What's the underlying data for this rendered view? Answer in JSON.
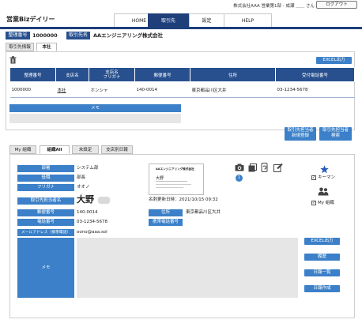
{
  "topbar": {
    "user_info": "株式会社AAA 営業第1部 - 成瀬 ＿＿ さん",
    "logout_label": "ログアウト"
  },
  "app": {
    "title": "営業Bizデイリー",
    "nav": [
      {
        "label": "HOME",
        "active": false
      },
      {
        "label": "取引先",
        "active": true
      },
      {
        "label": "設定",
        "active": false
      },
      {
        "label": "HELP",
        "active": false
      }
    ]
  },
  "header": {
    "id_label": "整理番号",
    "id_value": "1000000",
    "client_label": "取引先名",
    "client_value": "AAエンジニアリング株式会社"
  },
  "section_tabs": [
    {
      "label": "取引先情報",
      "active": false
    },
    {
      "label": "本社",
      "active": true
    }
  ],
  "office_table": {
    "excel_label": "EXCEL出力",
    "columns": [
      "整理番号",
      "支店名",
      "支店名\nフリガナ",
      "郵便番号",
      "住所",
      "受付電話番号"
    ],
    "rows": [
      [
        "1000000",
        "本社",
        "ホンシャ",
        "140-0014",
        "東京都品川区大井",
        "03-1234-5678"
      ]
    ],
    "memo_label": "メモ"
  },
  "contact_actions": {
    "register_label": "取引先担当者\n新規登録",
    "search_label": "取引先担当者\n検索"
  },
  "contact_tabs": [
    {
      "label": "My 組織",
      "active": false
    },
    {
      "label": "組織All",
      "active": true
    },
    {
      "label": "未設定",
      "active": false
    },
    {
      "label": "支店別日報",
      "active": false
    }
  ],
  "contact": {
    "department_label": "部署",
    "department_value": "システム部",
    "position_label": "役職",
    "position_value": "部長",
    "furigana_label": "フリガナ",
    "furigana_value": "オオノ",
    "name_label": "取引先担当者名",
    "name_value": "大野",
    "card_updated": "名刺更新日時：2021/10/15 09:32",
    "postal_label": "郵便番号",
    "postal_value": "140-0014",
    "address_label": "住所",
    "address_value": "東京都品川区大井",
    "phone_label": "電話番号",
    "phone_value": "03-1234-5678",
    "mobile_label": "携帯電話番号",
    "mobile_value": "",
    "email_label": "メールアドレス（携帯電話）",
    "email_value": "oono@aaa.sol",
    "memo_label": "メモ",
    "photo_count": "1",
    "keyman_label": "キーマン",
    "my_org_label": "My 組織",
    "card": {
      "company": "AAエンジニアリング株式会社",
      "name": "大野"
    }
  },
  "side_buttons": [
    "EXCEL出力",
    "履歴",
    "日報一覧",
    "日報作成"
  ],
  "colors": {
    "primary": "#28508f",
    "accent": "#3b80c8",
    "navy": "#1e3f7a"
  }
}
